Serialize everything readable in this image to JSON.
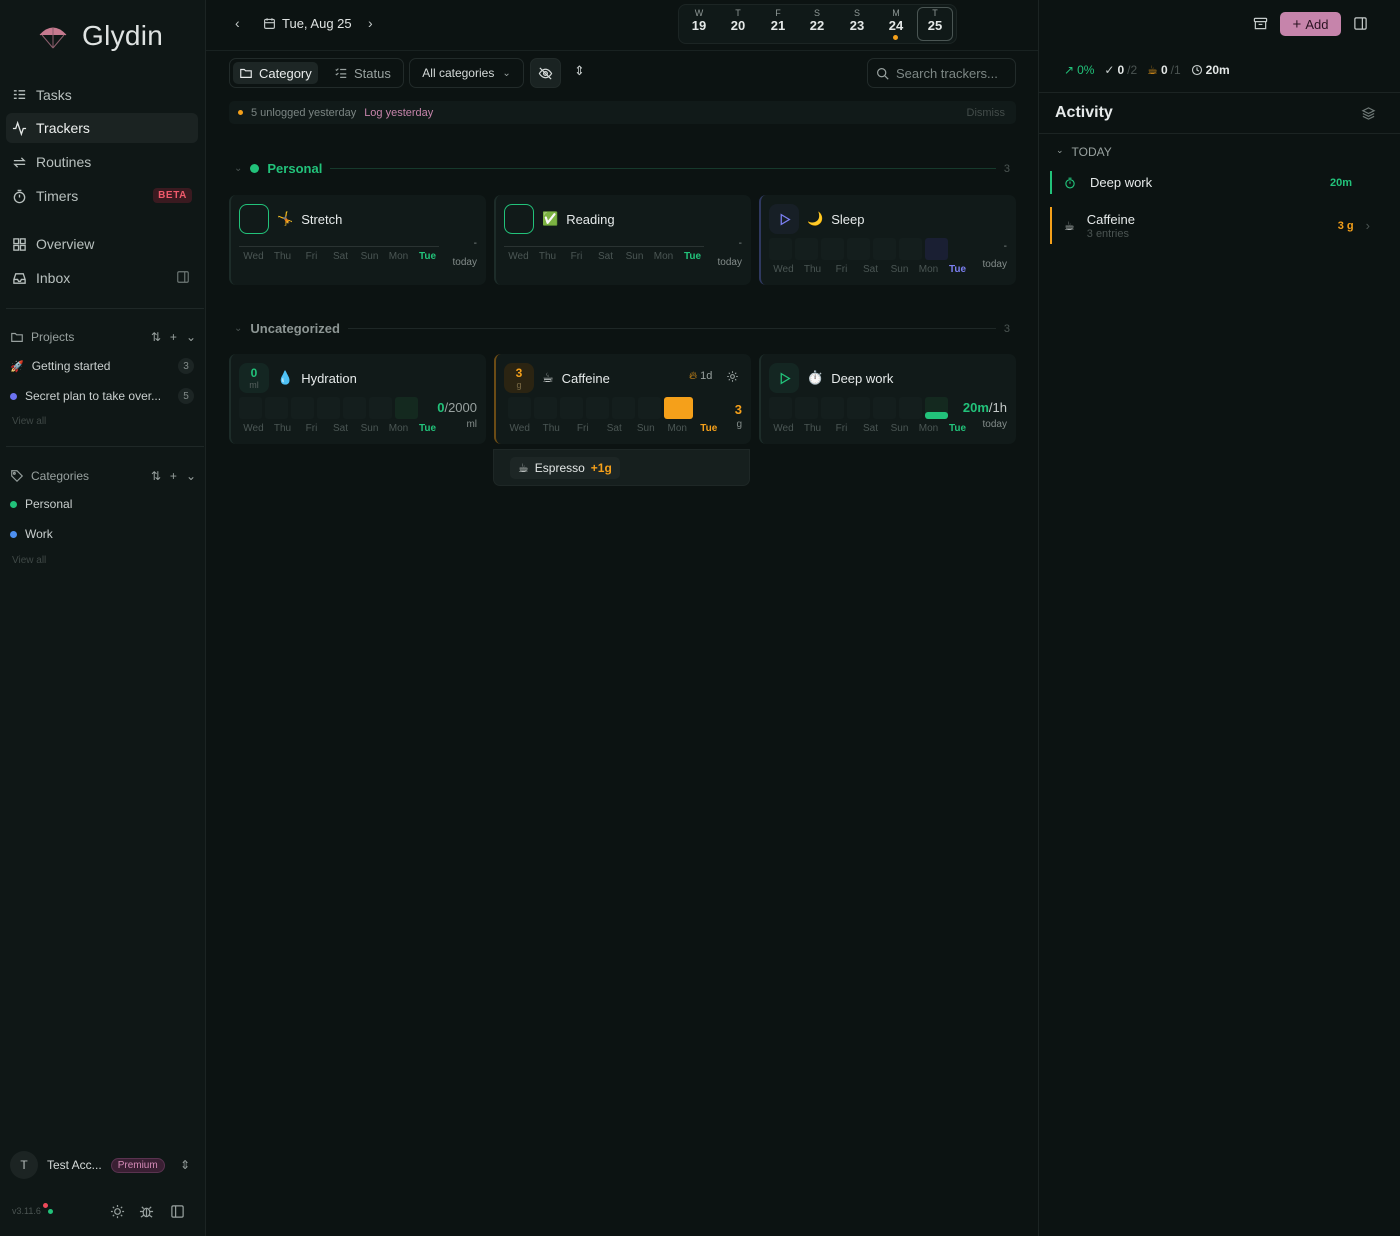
{
  "app": {
    "name": "Glydin",
    "version": "v3.11.6"
  },
  "nav": [
    {
      "label": "Tasks",
      "icon": "tasks-icon"
    },
    {
      "label": "Trackers",
      "icon": "activity-icon"
    },
    {
      "label": "Routines",
      "icon": "repeat-icon"
    },
    {
      "label": "Timers",
      "icon": "timer-icon",
      "badge": "BETA"
    },
    {
      "label": "Overview",
      "icon": "grid-icon"
    },
    {
      "label": "Inbox",
      "icon": "inbox-icon"
    }
  ],
  "projects": {
    "heading": "Projects",
    "items": [
      {
        "label": "Getting started",
        "count": "3",
        "icon": "rocket-icon"
      },
      {
        "label": "Secret plan to take over...",
        "count": "5",
        "color": "#6c72f0"
      }
    ],
    "view_all": "View all"
  },
  "categories": {
    "heading": "Categories",
    "items": [
      {
        "label": "Personal",
        "color": "#22c27a"
      },
      {
        "label": "Work",
        "color": "#4d8ff0"
      }
    ],
    "view_all": "View all"
  },
  "account": {
    "initial": "T",
    "name": "Test Acc...",
    "plan": "Premium"
  },
  "topbar": {
    "date": "Tue, Aug 25",
    "week": [
      {
        "letter": "W",
        "num": "19"
      },
      {
        "letter": "T",
        "num": "20"
      },
      {
        "letter": "F",
        "num": "21"
      },
      {
        "letter": "S",
        "num": "22"
      },
      {
        "letter": "S",
        "num": "23"
      },
      {
        "letter": "M",
        "num": "24",
        "marker": true
      },
      {
        "letter": "T",
        "num": "25",
        "selected": true
      }
    ],
    "add_label": "Add"
  },
  "toolbar": {
    "group_category": "Category",
    "group_status": "Status",
    "filter": "All categories",
    "search_placeholder": "Search trackers..."
  },
  "banner": {
    "text": "5 unlogged yesterday",
    "action": "Log yesterday",
    "dismiss": "Dismiss"
  },
  "groups": {
    "personal": {
      "label": "Personal",
      "count": "3",
      "color": "#22c27a"
    },
    "uncategorized": {
      "label": "Uncategorized",
      "count": "3"
    }
  },
  "weekdays": [
    "Wed",
    "Thu",
    "Fri",
    "Sat",
    "Sun",
    "Mon",
    "Tue"
  ],
  "trackers": {
    "stretch": {
      "emoji": "🤸",
      "name": "Stretch",
      "value": "-",
      "sub": "today"
    },
    "reading": {
      "emoji": "✅",
      "name": "Reading",
      "value": "-",
      "sub": "today"
    },
    "sleep": {
      "emoji": "🌙",
      "name": "Sleep",
      "value": "-",
      "sub": "today"
    },
    "hydration": {
      "emoji": "💧",
      "name": "Hydration",
      "badge_value": "0",
      "badge_unit": "ml",
      "value_done": "0",
      "value_goal": "/2000",
      "unit": "ml"
    },
    "caffeine": {
      "emoji": "☕",
      "name": "Caffeine",
      "badge_value": "3",
      "badge_unit": "g",
      "streak": "1d",
      "value": "3",
      "unit": "g"
    },
    "deepwork": {
      "emoji": "⏱️",
      "name": "Deep work",
      "value_done": "20m",
      "value_goal": "/1h",
      "sub": "today",
      "progress": 0.33
    }
  },
  "popover": {
    "emoji": "☕",
    "label": "Espresso",
    "amount": "+1g"
  },
  "stats": {
    "trend": "0%",
    "done": "0",
    "done_total": "/2",
    "cups": "0",
    "cups_total": "/1",
    "time": "20m"
  },
  "activity": {
    "title": "Activity",
    "section": "TODAY",
    "items": [
      {
        "name": "Deep work",
        "value": "20m",
        "sub": "",
        "color": "#22c27a"
      },
      {
        "name": "Caffeine",
        "value": "3 g",
        "sub": "3 entries",
        "color": "#f5a01a",
        "emoji": "☕"
      }
    ]
  }
}
